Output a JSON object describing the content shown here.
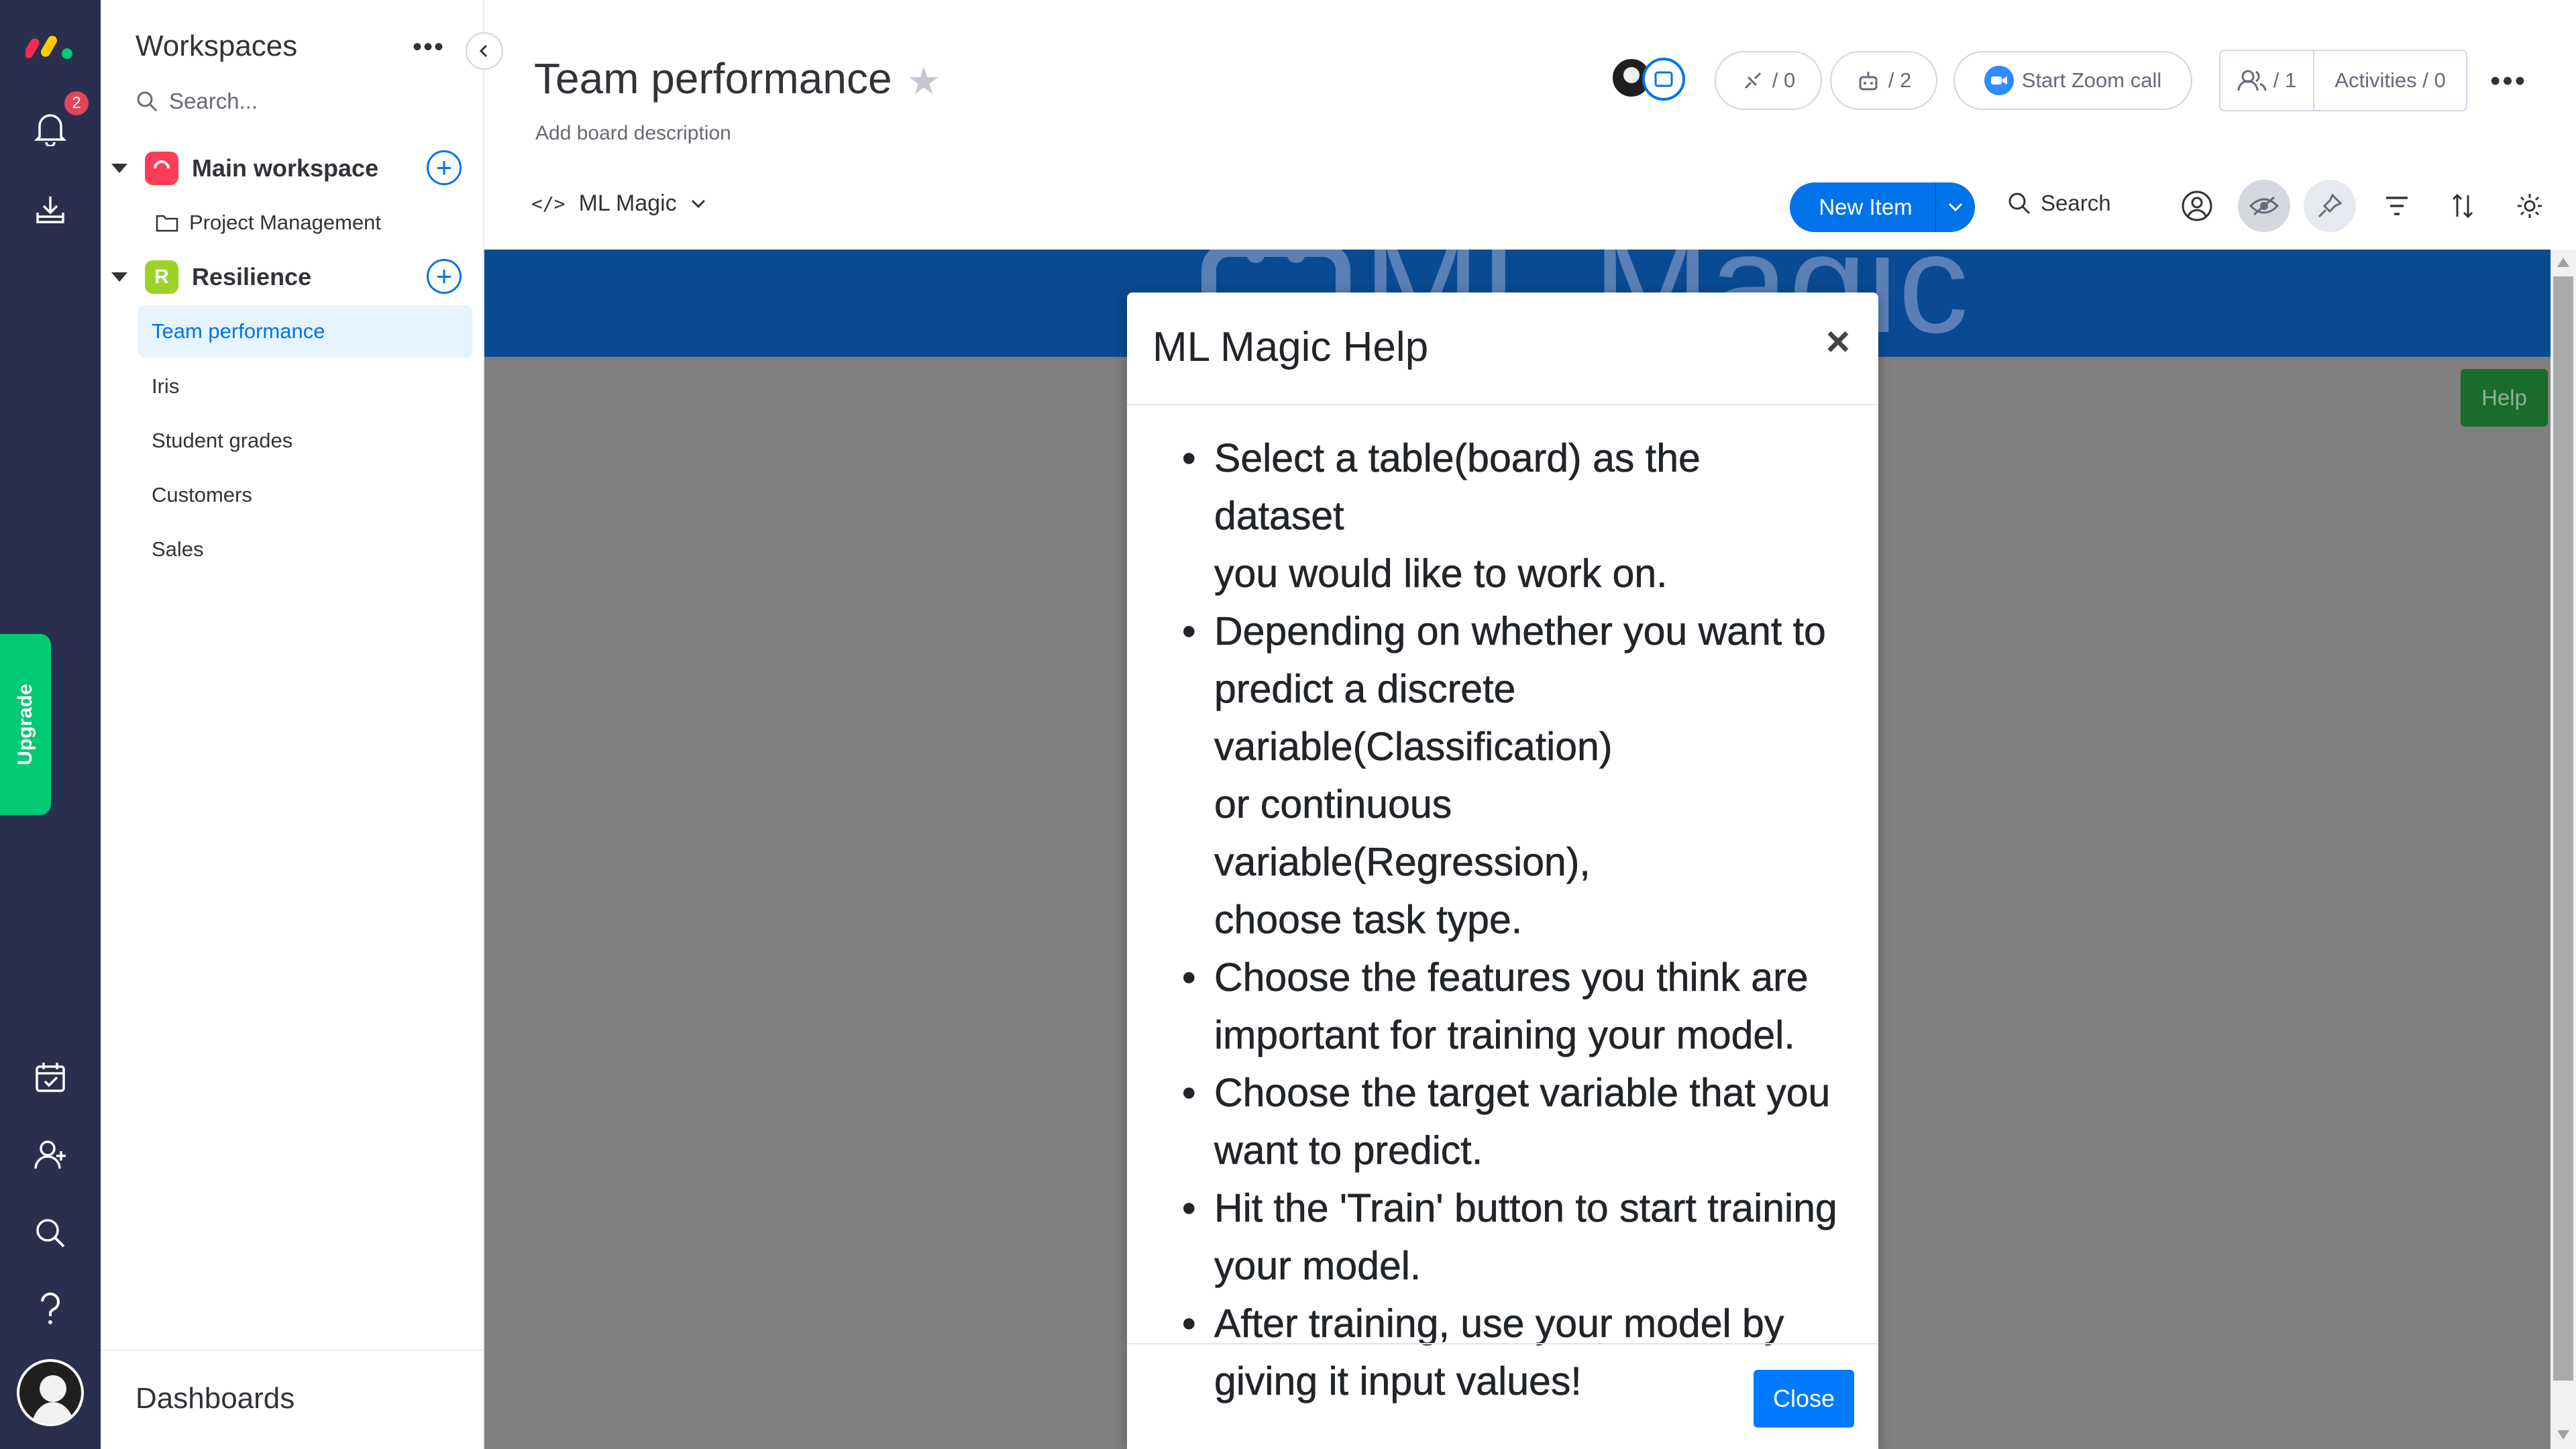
{
  "rail": {
    "notification_count": "2",
    "upgrade_label": "Upgrade"
  },
  "sidebar": {
    "title": "Workspaces",
    "search_placeholder": "Search...",
    "workspaces": [
      {
        "icon_letter": "",
        "name": "Main workspace",
        "color": "#ff3d57"
      },
      {
        "icon_letter": "R",
        "name": "Resilience",
        "color": "#9cd326"
      }
    ],
    "folder": "Project Management",
    "boards": [
      "Team performance",
      "Iris",
      "Student grades",
      "Customers",
      "Sales"
    ],
    "dashboards_label": "Dashboards"
  },
  "header": {
    "board_title": "Team performance",
    "board_description": "Add board description",
    "view_tab": "ML Magic",
    "integrations_count": "/ 0",
    "automations_count": "/ 2",
    "zoom_label": "Start Zoom call",
    "members_count": "/ 1",
    "activities_label": "Activities / 0"
  },
  "toolbar": {
    "new_item_label": "New Item",
    "search_label": "Search"
  },
  "content": {
    "banner_text": "ML Magic",
    "help_button": "Help"
  },
  "modal": {
    "title": "ML Magic Help",
    "close_x": "×",
    "items": [
      {
        "lines": [
          "Select a table(board) as the dataset",
          "you would like to work on."
        ]
      },
      {
        "lines": [
          "Depending on whether you want to",
          "predict a discrete",
          "variable(Classification)",
          "or continuous variable(Regression),",
          "choose task type."
        ]
      },
      {
        "lines": [
          "Choose the features you think are",
          "important for training your model."
        ]
      },
      {
        "lines": [
          "Choose the target variable that you",
          "want to predict."
        ]
      },
      {
        "lines": [
          "Hit the 'Train' button to start training",
          "your model."
        ]
      },
      {
        "lines": [
          "After training, use your model by",
          "giving it input values!"
        ]
      }
    ],
    "close_button": "Close"
  },
  "colors": {
    "rail": "#292f4c",
    "accent": "#0073ea",
    "upgrade": "#00ca72",
    "banner": "#0a4a92",
    "help": "#1b6b2b",
    "close_button": "#007bff"
  }
}
